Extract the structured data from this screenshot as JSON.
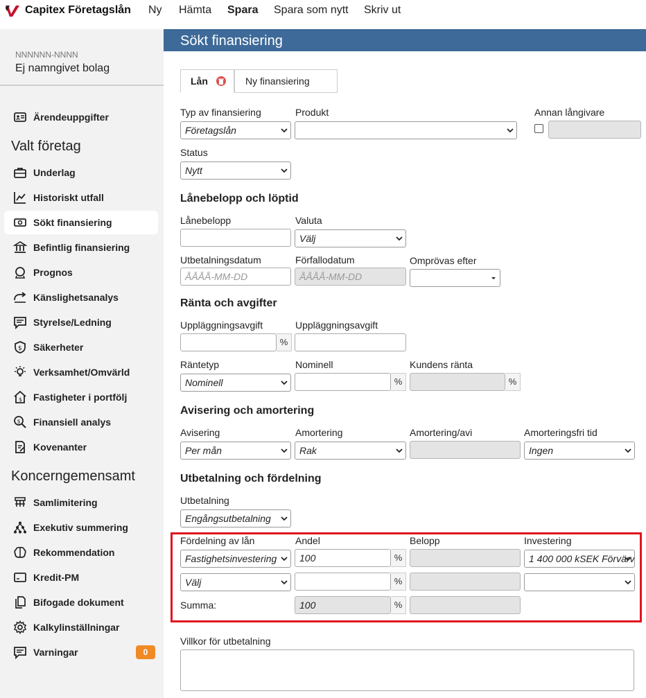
{
  "app": {
    "title": "Capitex Företagslån",
    "nav": [
      "Ny",
      "Hämta",
      "Spara",
      "Spara som nytt",
      "Skriv ut"
    ]
  },
  "company": {
    "id": "NNNNNN-NNNN",
    "name": "Ej namngivet bolag"
  },
  "sidebar": {
    "case_item": "Ärendeuppgifter",
    "section1": "Valt företag",
    "items1": [
      "Underlag",
      "Historiskt utfall",
      "Sökt finansiering",
      "Befintlig finansiering",
      "Prognos",
      "Känslighetsanalys",
      "Styrelse/Ledning",
      "Säkerheter",
      "Verksamhet/Omvärld",
      "Fastigheter i portfölj",
      "Finansiell analys",
      "Kovenanter"
    ],
    "section2": "Koncerngemensamt",
    "items2": [
      "Samlimitering",
      "Exekutiv summering",
      "Rekommendation",
      "Kredit-PM",
      "Bifogade dokument",
      "Kalkylinställningar",
      "Varningar"
    ],
    "warnings_count": "0",
    "active": "Sökt finansiering"
  },
  "main": {
    "title": "Sökt finansiering",
    "tabs": [
      "Lån",
      "Ny finansiering"
    ],
    "labels": {
      "typ": "Typ av finansiering",
      "produkt": "Produkt",
      "annan": "Annan långivare",
      "status": "Status",
      "lanebelopp": "Lånebelopp",
      "valuta": "Valuta",
      "utbetdatum": "Utbetalningsdatum",
      "forfallodatum": "Förfallodatum",
      "omprovas": "Omprövas efter",
      "uppl1": "Uppläggningsavgift",
      "uppl2": "Uppläggningsavgift",
      "rantetyp": "Räntetyp",
      "nominell": "Nominell",
      "kundens": "Kundens ränta",
      "avisering": "Avisering",
      "amortering": "Amortering",
      "amortavi": "Amortering/avi",
      "amortfri": "Amorteringsfri tid",
      "utbetalning": "Utbetalning",
      "fordelning": "Fördelning av lån",
      "andel": "Andel",
      "belopp": "Belopp",
      "investering": "Investering",
      "summa": "Summa:",
      "villkor": "Villkor för utbetalning"
    },
    "sections": {
      "lanebelopp": "Lånebelopp och löptid",
      "ranta": "Ränta och avgifter",
      "avisering": "Avisering och amortering",
      "utbetalning": "Utbetalning och fördelning"
    },
    "values": {
      "typ": "Företagslån",
      "status": "Nytt",
      "valuta": "Välj",
      "date_placeholder": "ÅÅÅÅ-MM-DD",
      "date_placeholder2": "ÅÅÅÅ-MM-DD",
      "rantetyp": "Nominell",
      "avisering": "Per mån",
      "amortering": "Rak",
      "amortfri": "Ingen",
      "utbetalning": "Engångsutbetalning",
      "fordelning1": "Fastighetsinvestering",
      "andel1": "100",
      "investering1": "1 400 000 kSEK Förvärv",
      "fordelning2": "Välj",
      "summa": "100",
      "pct": "%"
    }
  }
}
